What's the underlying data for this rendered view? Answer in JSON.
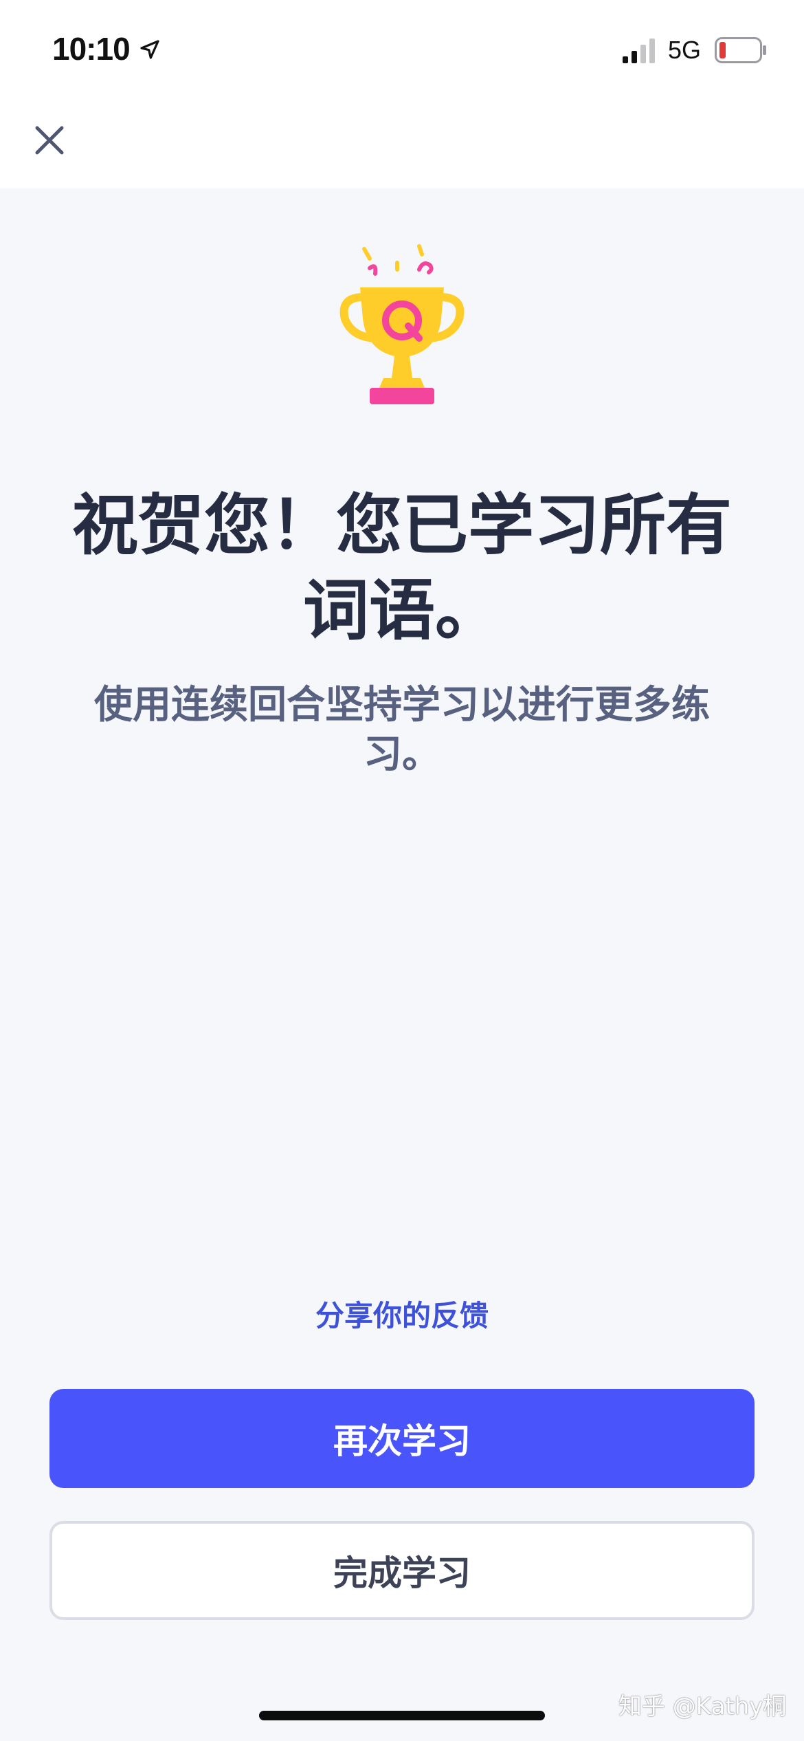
{
  "status_bar": {
    "time": "10:10",
    "network": "5G",
    "battery_color": "#e03a3a"
  },
  "nav": {
    "close_icon": "close-icon"
  },
  "main": {
    "trophy_icon": "trophy-icon",
    "headline": "祝贺您！您已学习所有词语。",
    "subtitle": "使用连续回合坚持学习以进行更多练习。",
    "feedback_link": "分享你的反馈"
  },
  "actions": {
    "study_again_label": "再次学习",
    "finish_label": "完成学习"
  },
  "watermark": "知乎 @Kathy桐",
  "colors": {
    "accent": "#4955fb",
    "link": "#3d52d9",
    "headline": "#262c41",
    "subtitle": "#586180",
    "background": "#f6f7fb",
    "trophy_gold": "#fecd29",
    "trophy_pink": "#f2459b"
  }
}
